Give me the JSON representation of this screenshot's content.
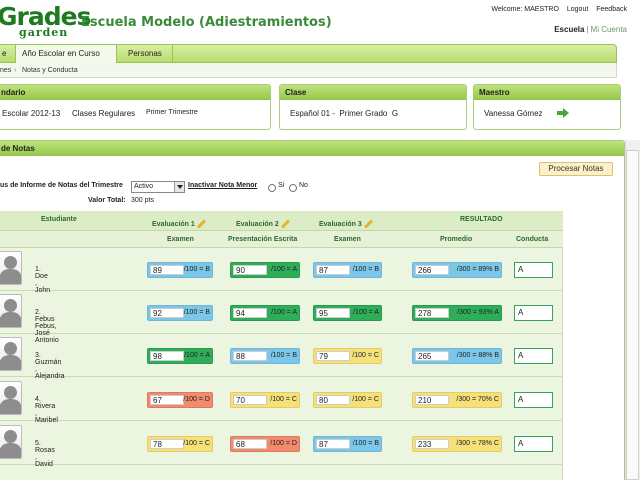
{
  "header": {
    "logo_main": "Grades",
    "logo_sub": "garden",
    "site_title": "Escuela Modelo (Adiestramientos)",
    "welcome": "Welcome: MAESTRO",
    "logout": "Logout",
    "feedback": "Feedback",
    "escuela": "Escuela",
    "sep": "|",
    "mi_cuenta": "Mi Cuenta"
  },
  "nav": {
    "tabs": [
      {
        "label": "e"
      },
      {
        "label": "Año Escolar en Curso"
      },
      {
        "label": "Personas"
      }
    ]
  },
  "breadcrumb": {
    "item1": "nes",
    "chev": "›",
    "item2": "Notas y Conducta"
  },
  "calendario": {
    "title": "ndario",
    "year": "Escolar 2012-13",
    "type": "Clases Regulares",
    "term": "Primer Trimestre"
  },
  "clase": {
    "title": "Clase",
    "name": "Español 01 -  Primer Grado  G"
  },
  "maestro": {
    "title": "Maestro",
    "name": "Vanessa Gómez"
  },
  "notas": {
    "title": "de Notas",
    "procesar_label": "Procesar Notas",
    "status_label": "us de Informe de Notas del Trimestre",
    "status_value": "Activo",
    "inactivar_label": "Inactivar Nota Menor",
    "si": "Si",
    "no": "No",
    "valor_total_label": "Valor Total:",
    "valor_total_value": "300 pts"
  },
  "grid": {
    "col_estudiante": "Estudiante",
    "eval1": "Evaluación 1",
    "eval2": "Evaluación 2",
    "eval3": "Evaluación 3",
    "resultado": "RESULTADO",
    "sub1": "Examen",
    "sub2": "Presentación Escrita",
    "sub3": "Examen",
    "sub_promedio": "Promedio",
    "sub_conducta": "Conducta"
  },
  "colors": {
    "A": {
      "bg": "#2fae5a",
      "border": "#2a9a4e"
    },
    "B": {
      "bg": "#7cc7e8",
      "border": "#6db8da"
    },
    "C": {
      "bg": "#f5e07a",
      "border": "#e3cc62"
    },
    "D": {
      "bg": "#f28a6e",
      "border": "#e07a5e"
    }
  },
  "students": [
    {
      "name": "1. Doe , John",
      "scores": [
        {
          "v": "89",
          "r": "/100 = B",
          "g": "B"
        },
        {
          "v": "90",
          "r": "/100 = A",
          "g": "A"
        },
        {
          "v": "87",
          "r": "/100 = B",
          "g": "B"
        }
      ],
      "avg": {
        "v": "266",
        "r": "/300 = 89% B",
        "g": "B"
      },
      "conduct": "A"
    },
    {
      "name": "2. Febus Febus, José Antonio",
      "scores": [
        {
          "v": "92",
          "r": "/100 = B",
          "g": "B"
        },
        {
          "v": "94",
          "r": "/100 = A",
          "g": "A"
        },
        {
          "v": "95",
          "r": "/100 = A",
          "g": "A"
        }
      ],
      "avg": {
        "v": "278",
        "r": "/300 = 93% A",
        "g": "A"
      },
      "conduct": "A"
    },
    {
      "name": "3. Guzmán , Alejandra",
      "scores": [
        {
          "v": "98",
          "r": "/100 = A",
          "g": "A"
        },
        {
          "v": "88",
          "r": "/100 = B",
          "g": "B"
        },
        {
          "v": "79",
          "r": "/100 = C",
          "g": "C"
        }
      ],
      "avg": {
        "v": "265",
        "r": "/300 = 88% B",
        "g": "B"
      },
      "conduct": "A"
    },
    {
      "name": "4. Rivera , Maribel",
      "scores": [
        {
          "v": "67",
          "r": "/100 = D",
          "g": "D"
        },
        {
          "v": "70",
          "r": "/100 = C",
          "g": "C"
        },
        {
          "v": "80",
          "r": "/100 = C",
          "g": "C"
        }
      ],
      "avg": {
        "v": "210",
        "r": "/300 = 70% C",
        "g": "C"
      },
      "conduct": "A"
    },
    {
      "name": "5. Rosas , David",
      "scores": [
        {
          "v": "78",
          "r": "/100 = C",
          "g": "C"
        },
        {
          "v": "68",
          "r": "/100 = D",
          "g": "D"
        },
        {
          "v": "87",
          "r": "/100 = B",
          "g": "B"
        }
      ],
      "avg": {
        "v": "233",
        "r": "/300 = 78% C",
        "g": "C"
      },
      "conduct": "A"
    }
  ]
}
